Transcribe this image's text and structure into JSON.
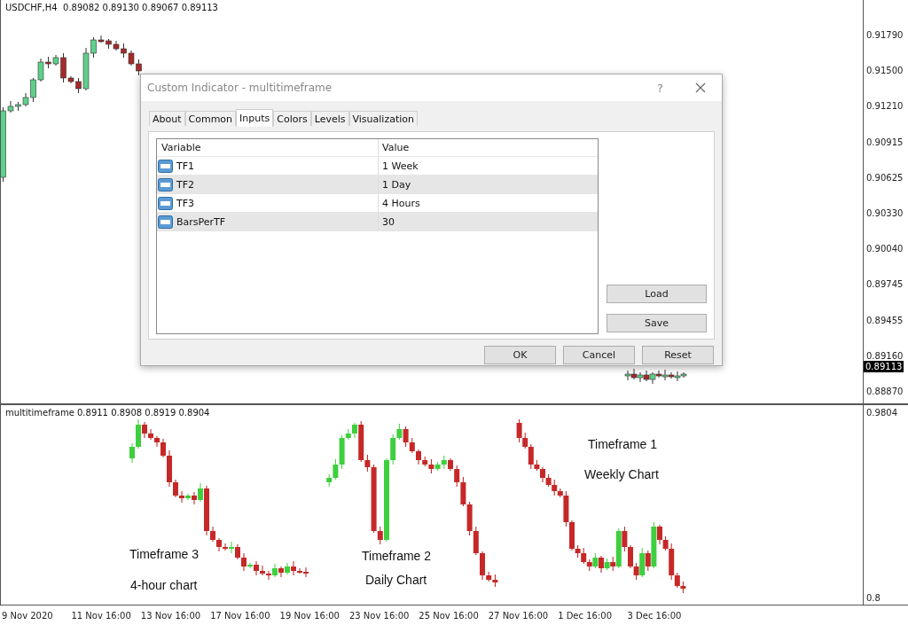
{
  "chart": {
    "header": "USDCHF,H4  0.89082 0.89130 0.89067 0.89113",
    "price_scale": [
      "0.91790",
      "0.91500",
      "0.91210",
      "0.90915",
      "0.90625",
      "0.90330",
      "0.90040",
      "0.89745",
      "0.89455",
      "0.89160",
      "0.88870"
    ],
    "current_price": "0.89113"
  },
  "indicator_pane": {
    "header": "multitimeframe 0.8911 0.8908 0.8919 0.8904",
    "scale": [
      "0.9804",
      "0.8"
    ],
    "annotations": [
      {
        "text": "Timeframe 3",
        "kind": "label"
      },
      {
        "text": "4-hour chart",
        "kind": "label"
      },
      {
        "text": "Timeframe 2",
        "kind": "label"
      },
      {
        "text": "Daily Chart",
        "kind": "label"
      },
      {
        "text": "Timeframe 1",
        "kind": "label"
      },
      {
        "text": "Weekly Chart",
        "kind": "label"
      }
    ]
  },
  "time_axis": [
    "9 Nov 2020",
    "11 Nov 16:00",
    "13 Nov 16:00",
    "17 Nov 16:00",
    "19 Nov 16:00",
    "23 Nov 16:00",
    "25 Nov 16:00",
    "27 Nov 16:00",
    "1 Dec 16:00",
    "3 Dec 16:00"
  ],
  "dialog": {
    "title": "Custom Indicator - multitimeframe",
    "help": "?",
    "tabs": [
      {
        "label": "About",
        "selected": false
      },
      {
        "label": "Common",
        "selected": false
      },
      {
        "label": "Inputs",
        "selected": true
      },
      {
        "label": "Colors",
        "selected": false
      },
      {
        "label": "Levels",
        "selected": false
      },
      {
        "label": "Visualization",
        "selected": false
      }
    ],
    "table": {
      "columns": [
        "Variable",
        "Value"
      ],
      "rows": [
        {
          "variable": "TF1",
          "value": "1 Week"
        },
        {
          "variable": "TF2",
          "value": "1 Day"
        },
        {
          "variable": "TF3",
          "value": "4 Hours"
        },
        {
          "variable": "BarsPerTF",
          "value": "30"
        }
      ]
    },
    "side_buttons": [
      "Load",
      "Save"
    ],
    "buttons": [
      "OK",
      "Cancel",
      "Reset"
    ]
  }
}
